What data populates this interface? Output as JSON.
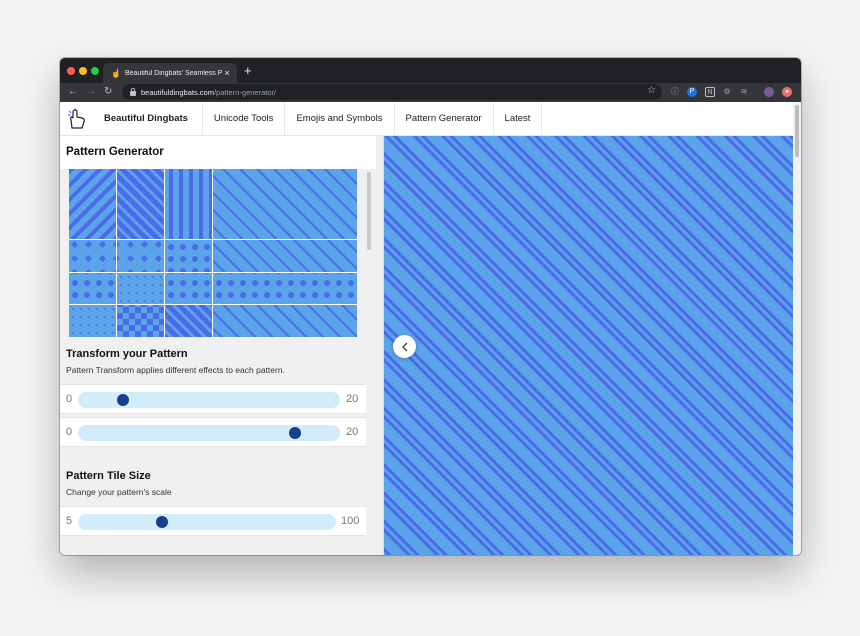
{
  "browser": {
    "tab_title": "Beautiful Dingbats' Seamless Pa",
    "url_host": "beautifuldingbats.com",
    "url_path": "/pattern-generator/"
  },
  "nav": {
    "brand": "Beautiful Dingbats",
    "links": [
      "Unicode Tools",
      "Emojis and Symbols",
      "Pattern Generator",
      "Latest"
    ]
  },
  "panel": {
    "title": "Pattern Generator",
    "transform": {
      "heading": "Transform your Pattern",
      "description": "Pattern Transform applies different effects to each pattern.",
      "sliders": [
        {
          "min": "0",
          "max": "20",
          "value": 3
        },
        {
          "min": "0",
          "max": "20",
          "value": 17
        }
      ]
    },
    "tile_size": {
      "heading": "Pattern Tile Size",
      "description": "Change your pattern's scale",
      "slider": {
        "min": "5",
        "max": "100",
        "value": 35
      }
    }
  },
  "icons": {
    "back": "arrow-left-icon",
    "forward": "arrow-right-icon",
    "reload": "reload-icon",
    "lock": "lock-icon",
    "star": "star-icon",
    "collapse": "chevron-left-icon"
  },
  "colors": {
    "pattern_bg": "#5ba4ea",
    "pattern_stripe": "#4b6bea",
    "slider_track": "#d2ecfa",
    "slider_knob": "#173f8c"
  }
}
